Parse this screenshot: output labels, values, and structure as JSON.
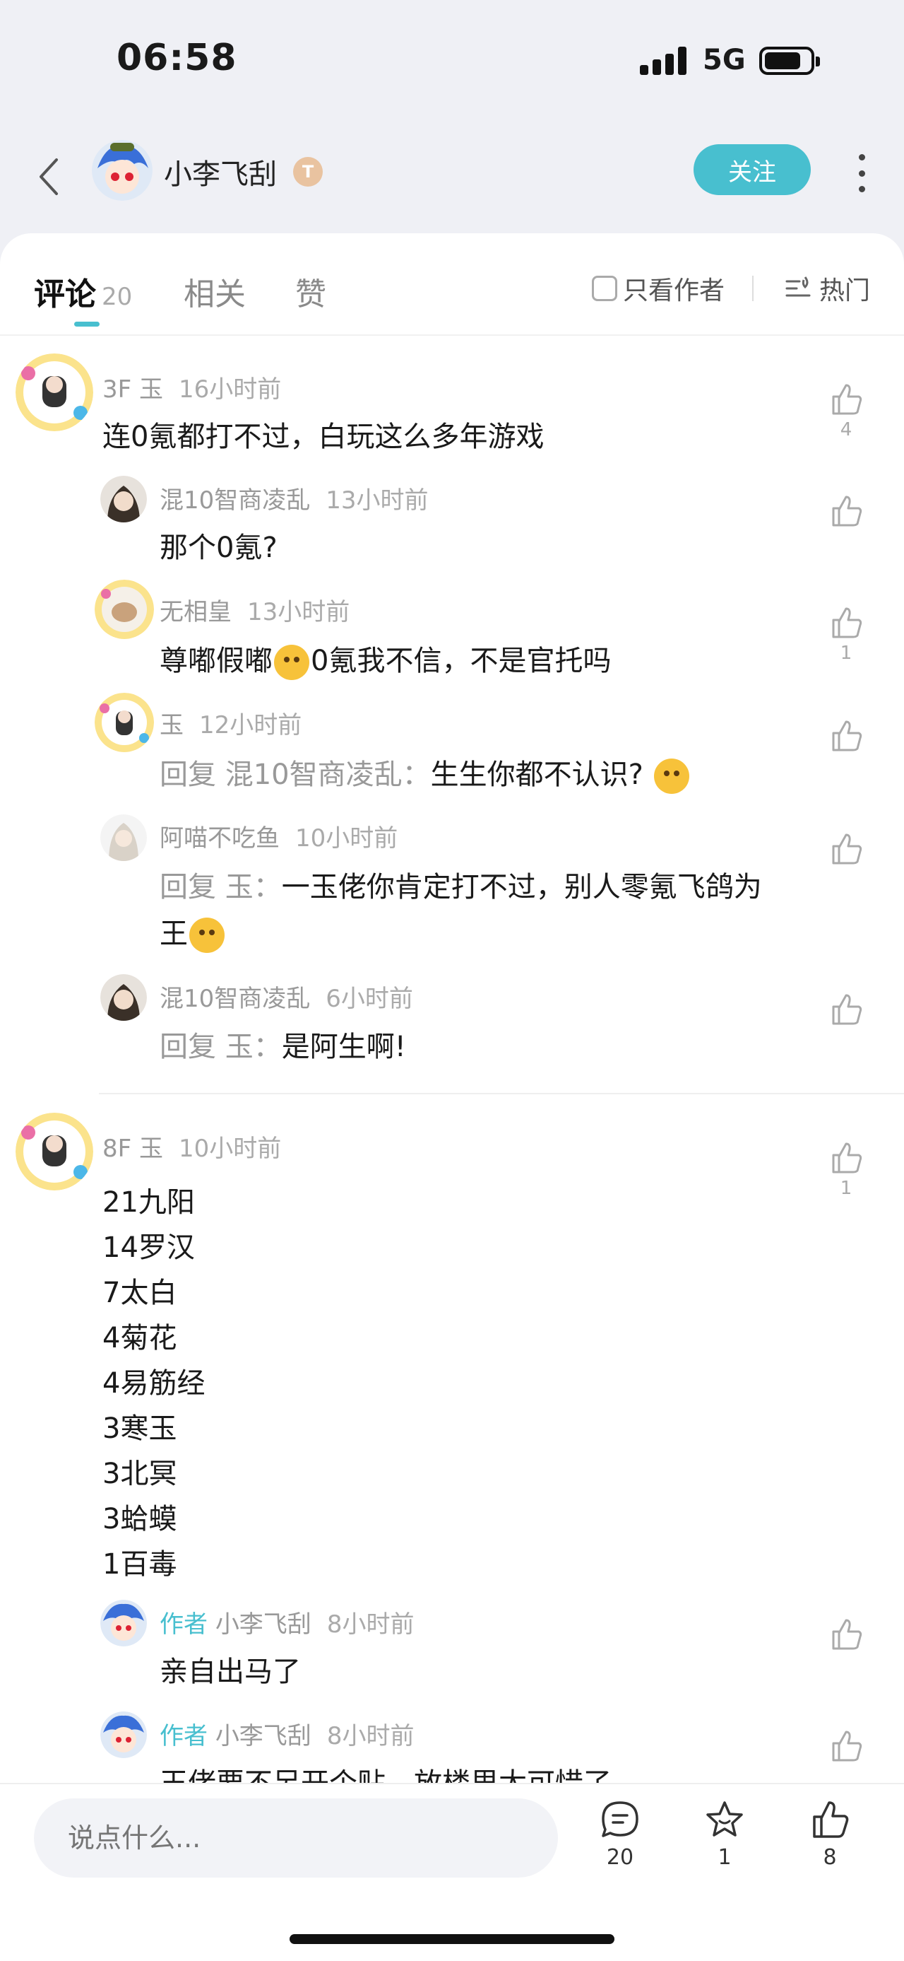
{
  "status_bar": {
    "time": "06:58",
    "network": "5G"
  },
  "header": {
    "username": "小李飞刮",
    "badge": "T",
    "follow_label": "关注"
  },
  "tabs": [
    {
      "label": "评论",
      "count": "20"
    },
    {
      "label": "相关"
    },
    {
      "label": "赞"
    }
  ],
  "filter": {
    "author_only": "只看作者",
    "sort": "热门"
  },
  "comments": [
    {
      "floor": "3F",
      "name": "玉",
      "time": "16小时前",
      "text": "连0氪都打不过，白玩这么多年游戏",
      "likes": "4",
      "replies": [
        {
          "name": "混10智商凌乱",
          "time": "13小时前",
          "text": "那个0氪?"
        },
        {
          "name": "无相皇",
          "time": "13小时前",
          "text_a": "尊嘟假嘟",
          "text_b": "0氪我不信，不是官托吗",
          "likes": "1"
        },
        {
          "name": "玉",
          "time": "12小时前",
          "prefix": "回复 混10智商凌乱：",
          "text": "生生你都不认识?"
        },
        {
          "name": "阿喵不吃鱼",
          "time": "10小时前",
          "prefix": "回复 玉：",
          "text_line1": "一玉佬你肯定打不过，别人零氪飞鸽为",
          "text_line2": "王"
        },
        {
          "name": "混10智商凌乱",
          "time": "6小时前",
          "prefix": "回复 玉：",
          "text": "是阿生啊!"
        }
      ]
    },
    {
      "floor": "8F",
      "name": "玉",
      "time": "10小时前",
      "likes": "1",
      "lines": [
        "21九阳",
        "14罗汉",
        "7太白",
        "4菊花",
        "4易筋经",
        "3寒玉",
        "3北冥",
        "3蛤蟆",
        "1百毒"
      ],
      "replies": [
        {
          "tag": "作者",
          "name": "小李飞刮",
          "time": "8小时前",
          "text": "亲自出马了"
        },
        {
          "tag": "作者",
          "name": "小李飞刮",
          "time": "8小时前",
          "text": "玉佬要不另开个贴，放楼里太可惜了"
        }
      ]
    }
  ],
  "bottom_bar": {
    "placeholder": "说点什么...",
    "comments": "20",
    "favorites": "1",
    "likes": "8"
  }
}
